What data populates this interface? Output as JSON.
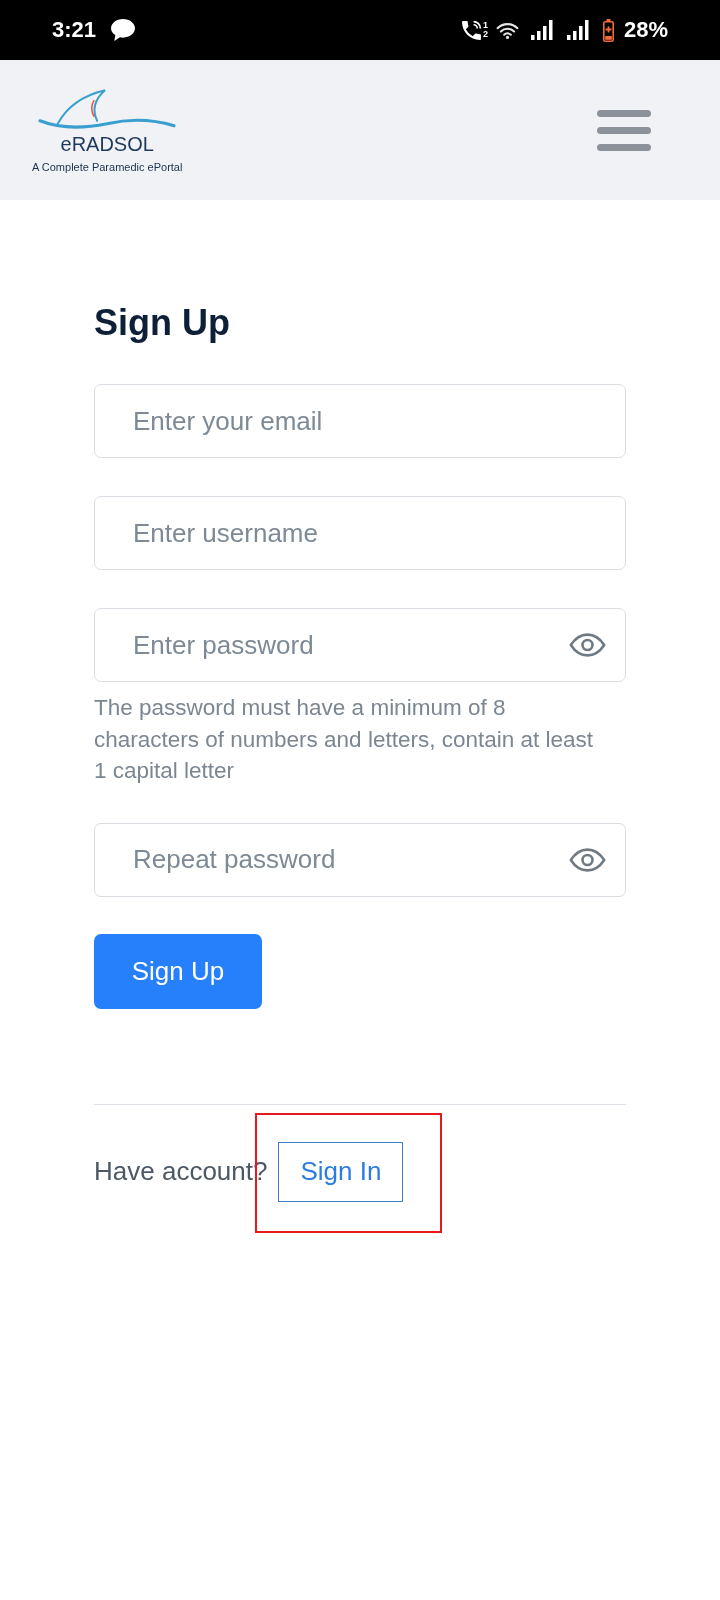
{
  "status_bar": {
    "time": "3:21",
    "sim_marks": [
      "1",
      "2"
    ],
    "battery": "28%"
  },
  "header": {
    "logo": {
      "name": "eRADSOL",
      "tagline": "A Complete Paramedic ePortal"
    }
  },
  "form": {
    "title": "Sign Up",
    "fields": [
      {
        "kind": "email",
        "placeholder": "Enter your email"
      },
      {
        "kind": "username",
        "placeholder": "Enter username"
      },
      {
        "kind": "password",
        "placeholder": "Enter password",
        "hint": "The password must have a minimum of 8 characters of numbers and letters, contain at least 1 capital letter"
      },
      {
        "kind": "password",
        "placeholder": "Repeat password"
      }
    ],
    "submit": "Sign Up"
  },
  "footer": {
    "prompt": "Have account?",
    "sign_in": {
      "label": "Sign In",
      "highlighted": true
    }
  }
}
